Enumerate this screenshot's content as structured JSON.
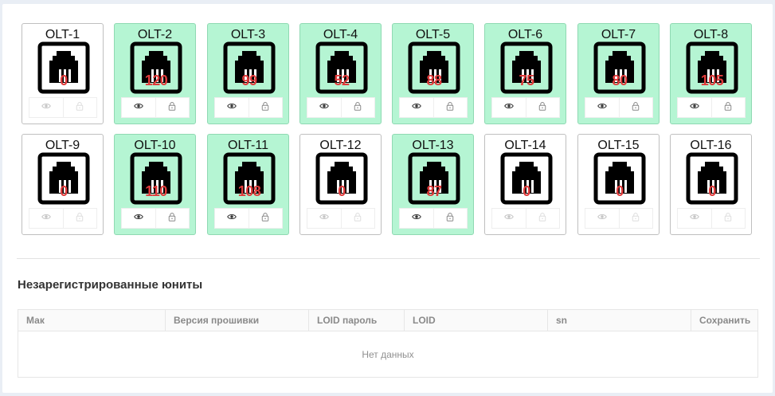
{
  "olts": [
    {
      "name": "OLT-1",
      "count": "0",
      "active": false
    },
    {
      "name": "OLT-2",
      "count": "120",
      "active": true
    },
    {
      "name": "OLT-3",
      "count": "99",
      "active": true
    },
    {
      "name": "OLT-4",
      "count": "52",
      "active": true
    },
    {
      "name": "OLT-5",
      "count": "88",
      "active": true
    },
    {
      "name": "OLT-6",
      "count": "75",
      "active": true
    },
    {
      "name": "OLT-7",
      "count": "80",
      "active": true
    },
    {
      "name": "OLT-8",
      "count": "105",
      "active": true
    },
    {
      "name": "OLT-9",
      "count": "0",
      "active": false
    },
    {
      "name": "OLT-10",
      "count": "110",
      "active": true
    },
    {
      "name": "OLT-11",
      "count": "108",
      "active": true
    },
    {
      "name": "OLT-12",
      "count": "0",
      "active": false
    },
    {
      "name": "OLT-13",
      "count": "87",
      "active": true
    },
    {
      "name": "OLT-14",
      "count": "0",
      "active": false
    },
    {
      "name": "OLT-15",
      "count": "0",
      "active": false
    },
    {
      "name": "OLT-16",
      "count": "0",
      "active": false
    }
  ],
  "colors": {
    "active_bg": "#b5f5d3",
    "count": "#e03b3b"
  },
  "icons": {
    "port": "ethernet-port-icon",
    "view": "eye-icon",
    "lock": "lock-icon"
  },
  "unregistered": {
    "title": "Незарегистрированные юниты",
    "columns": [
      "Мак",
      "Версия прошивки",
      "LOID пароль",
      "LOID",
      "sn",
      "Сохранить"
    ],
    "empty_text": "Нет данных"
  }
}
